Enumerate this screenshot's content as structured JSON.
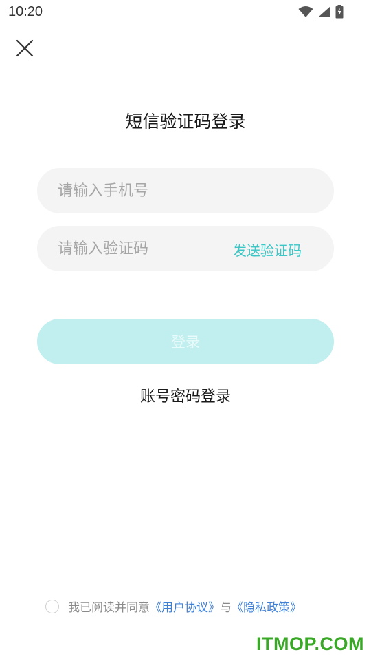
{
  "status_bar": {
    "time": "10:20",
    "icons": [
      "wifi-icon",
      "signal-icon",
      "battery-charging-icon"
    ]
  },
  "header": {
    "close_icon": "close-icon",
    "title": "短信验证码登录"
  },
  "form": {
    "phone_placeholder": "请输入手机号",
    "phone_value": "",
    "code_placeholder": "请输入验证码",
    "code_value": "",
    "send_code_label": "发送验证码",
    "login_label": "登录"
  },
  "alt_login_label": "账号密码登录",
  "agreement": {
    "checked": false,
    "prefix": "我已阅读并同意",
    "user_agreement": "《用户协议》",
    "connector": "与",
    "privacy_policy": "《隐私政策》"
  },
  "watermark": "ITMOP.COM",
  "colors": {
    "accent": "#3cc6c6",
    "login_disabled_bg": "#c1eeee",
    "link": "#3f80d6",
    "field_bg": "#f4f4f4",
    "watermark": "#39a826"
  }
}
